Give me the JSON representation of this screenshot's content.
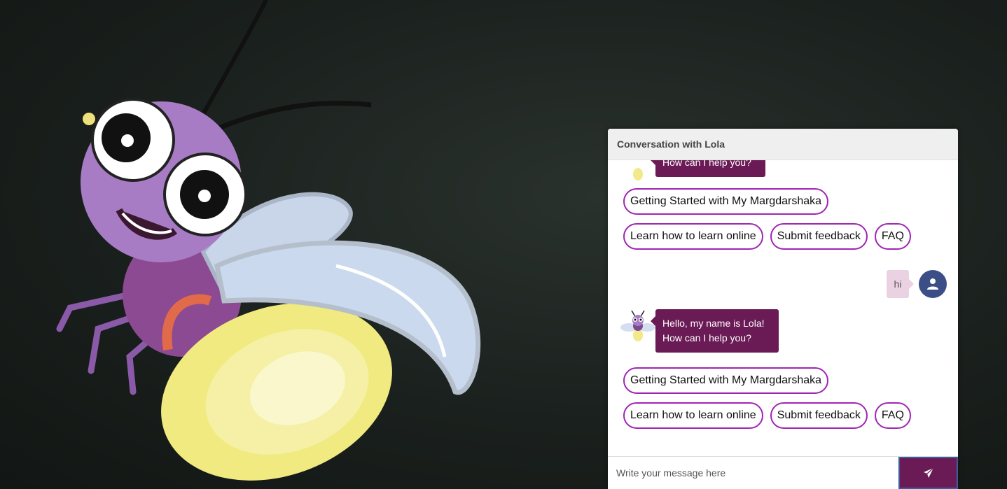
{
  "chat": {
    "header_title": "Conversation with Lola",
    "top_partial_message": "How can I help you?",
    "first_options": {
      "row1": [
        "Getting Started with My Margdarshaka"
      ],
      "row2": [
        "Learn how to learn online",
        "Submit feedback",
        "FAQ"
      ]
    },
    "user_message": "hi",
    "bot_message": "Hello, my name is Lola!\nHow can I help you?",
    "second_options": {
      "row1": [
        "Getting Started with My Margdarshaka"
      ],
      "row2": [
        "Learn how to learn online",
        "Submit feedback",
        "FAQ"
      ]
    },
    "input_placeholder": "Write your message here"
  },
  "colors": {
    "bot_bubble": "#6a1b55",
    "chip_border": "#a024b4",
    "user_bubble": "#ead2e3",
    "user_avatar": "#3b4e86"
  },
  "icons": {
    "send": "paper-plane-icon",
    "user": "user-icon",
    "bot": "firefly-icon"
  }
}
